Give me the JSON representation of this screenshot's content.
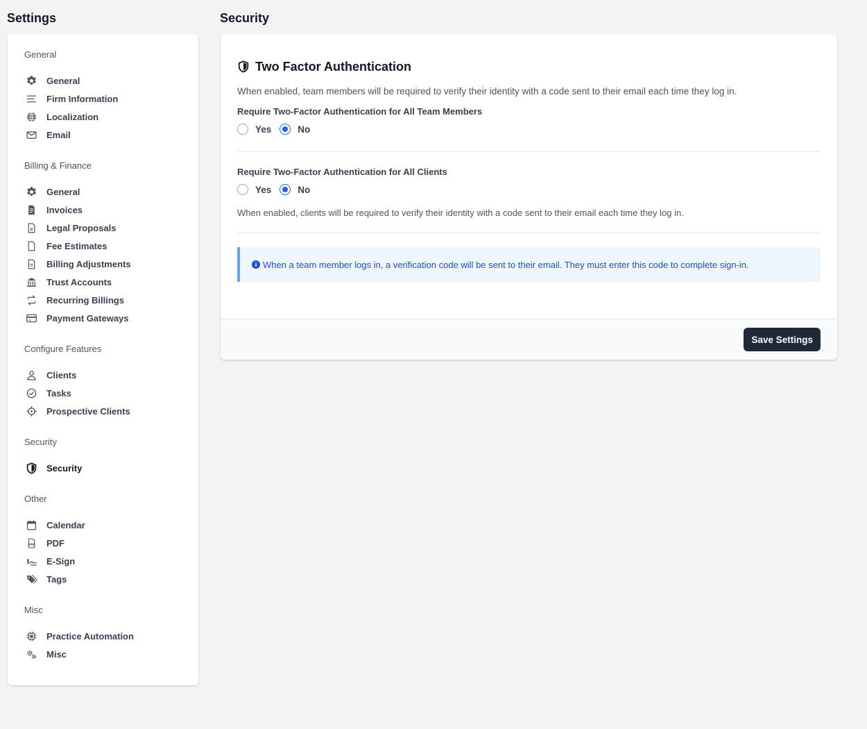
{
  "sidebar": {
    "title": "Settings",
    "groups": [
      {
        "label": "General",
        "items": [
          {
            "label": "General",
            "icon": "gear-icon"
          },
          {
            "label": "Firm Information",
            "icon": "lines-icon"
          },
          {
            "label": "Localization",
            "icon": "globe-icon"
          },
          {
            "label": "Email",
            "icon": "envelope-icon"
          }
        ]
      },
      {
        "label": "Billing & Finance",
        "items": [
          {
            "label": "General",
            "icon": "gear-icon"
          },
          {
            "label": "Invoices",
            "icon": "invoice-icon"
          },
          {
            "label": "Legal Proposals",
            "icon": "document-p-icon"
          },
          {
            "label": "Fee Estimates",
            "icon": "document-icon"
          },
          {
            "label": "Billing Adjustments",
            "icon": "document-lines-icon"
          },
          {
            "label": "Trust Accounts",
            "icon": "bank-icon"
          },
          {
            "label": "Recurring Billings",
            "icon": "repeat-icon"
          },
          {
            "label": "Payment Gateways",
            "icon": "credit-card-icon"
          }
        ]
      },
      {
        "label": "Configure Features",
        "items": [
          {
            "label": "Clients",
            "icon": "user-icon"
          },
          {
            "label": "Tasks",
            "icon": "check-circle-icon"
          },
          {
            "label": "Prospective Clients",
            "icon": "crosshair-icon"
          }
        ]
      },
      {
        "label": "Security",
        "items": [
          {
            "label": "Security",
            "icon": "shield-icon",
            "active": true
          }
        ]
      },
      {
        "label": "Other",
        "items": [
          {
            "label": "Calendar",
            "icon": "calendar-icon"
          },
          {
            "label": "PDF",
            "icon": "pdf-icon"
          },
          {
            "label": "E-Sign",
            "icon": "signature-icon"
          },
          {
            "label": "Tags",
            "icon": "tags-icon"
          }
        ]
      },
      {
        "label": "Misc",
        "items": [
          {
            "label": "Practice Automation",
            "icon": "chip-icon"
          },
          {
            "label": "Misc",
            "icon": "gears-icon"
          }
        ]
      }
    ]
  },
  "main": {
    "title": "Security",
    "card": {
      "heading": "Two Factor Authentication",
      "description": "When enabled, team members will be required to verify their identity with a code sent to their email each time they log in.",
      "team_question": "Require Two-Factor Authentication for All Team Members",
      "client_question": "Require Two-Factor Authentication for All Clients",
      "yes_label": "Yes",
      "no_label": "No",
      "team_value": "No",
      "client_value": "No",
      "client_description": "When enabled, clients will be required to verify their identity with a code sent to their email each time they log in.",
      "info_text": "When a team member logs in, a verification code will be sent to their email. They must enter this code to complete sign-in.",
      "save_label": "Save Settings"
    }
  },
  "colors": {
    "accent": "#2563eb",
    "button_bg": "#1f2937",
    "info_bg": "#eff6ff",
    "info_border": "#60a5fa",
    "info_text": "#1d4ed8"
  }
}
